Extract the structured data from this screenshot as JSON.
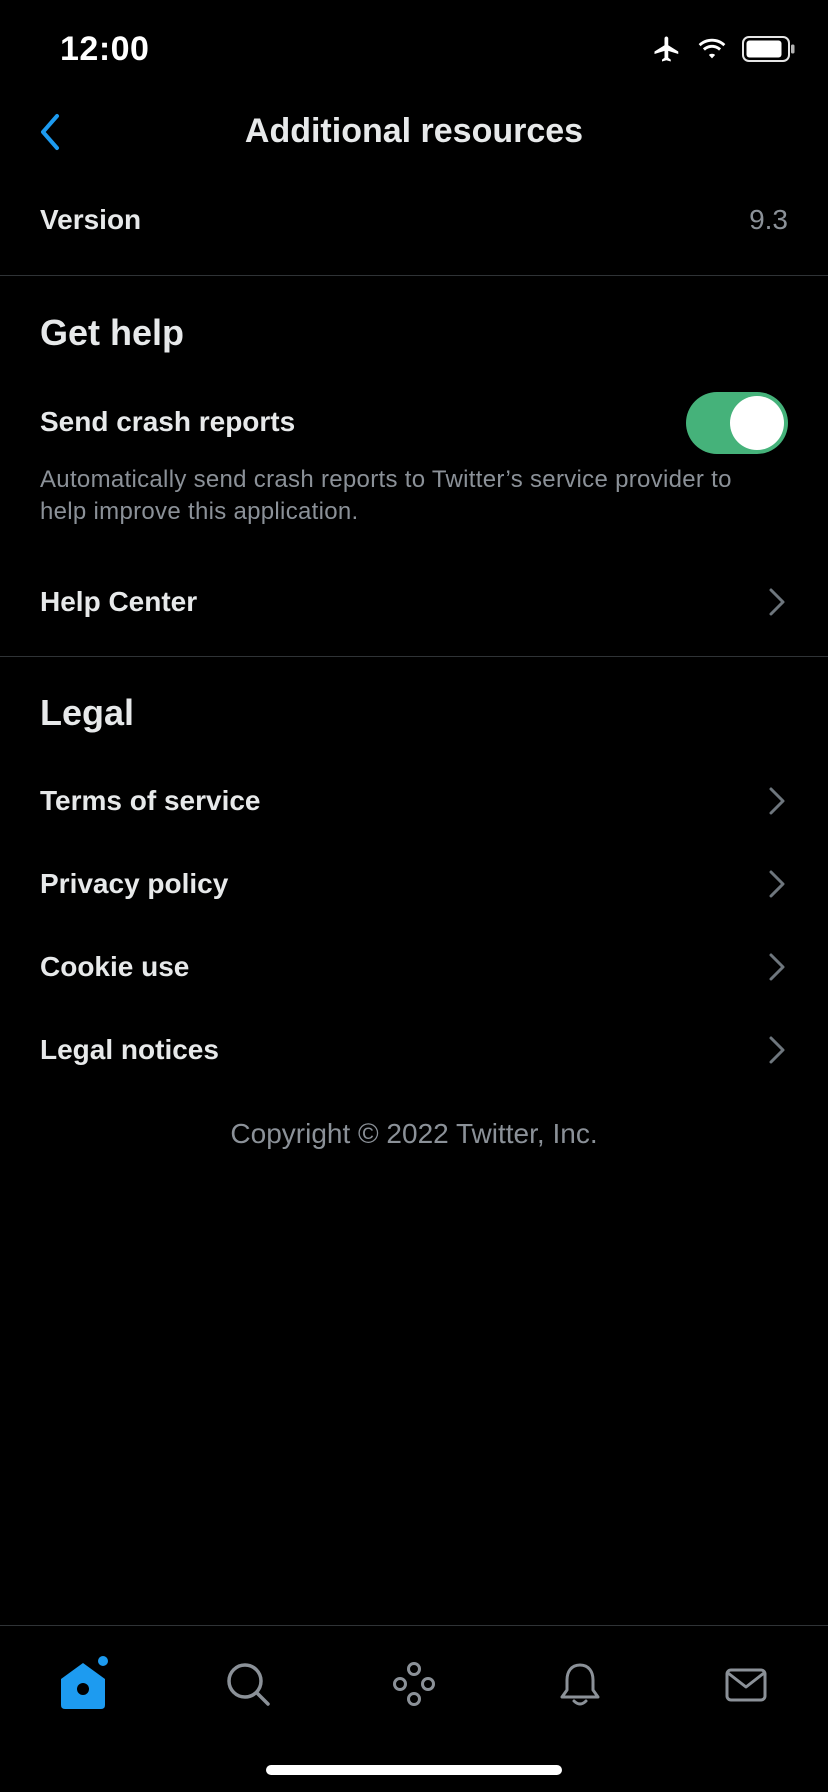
{
  "status_bar": {
    "time": "12:00"
  },
  "header": {
    "title": "Additional resources"
  },
  "version": {
    "label": "Version",
    "value": "9.3"
  },
  "get_help": {
    "title": "Get help",
    "crash_reports": {
      "label": "Send crash reports",
      "enabled": true,
      "description": "Automatically send crash reports to Twitter’s service provider to help improve this application."
    },
    "help_center": "Help Center"
  },
  "legal": {
    "title": "Legal",
    "items": [
      {
        "label": "Terms of service"
      },
      {
        "label": "Privacy policy"
      },
      {
        "label": "Cookie use"
      },
      {
        "label": "Legal notices"
      }
    ]
  },
  "footer": {
    "copyright": "Copyright © 2022 Twitter, Inc."
  },
  "tab_bar": {
    "tabs": [
      {
        "icon": "home-icon",
        "active": true
      },
      {
        "icon": "search-icon",
        "active": false
      },
      {
        "icon": "spaces-icon",
        "active": false
      },
      {
        "icon": "bell-icon",
        "active": false
      },
      {
        "icon": "mail-icon",
        "active": false
      }
    ]
  },
  "colors": {
    "accent": "#1d9bf0",
    "toggle_on": "#45b27a",
    "background": "#000000",
    "secondary_text": "#8b9198",
    "divider": "#2f3336"
  }
}
